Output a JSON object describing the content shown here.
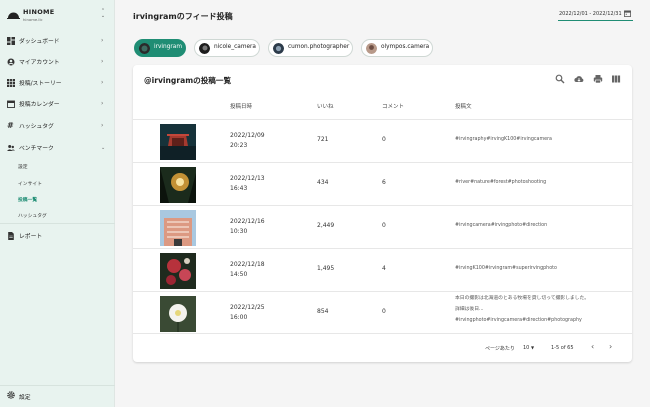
{
  "brand": {
    "name": "HINOME",
    "sub": "hinome.llc"
  },
  "sidebar": {
    "items": [
      {
        "label": "ダッシュボード"
      },
      {
        "label": "マイアカウント"
      },
      {
        "label": "投稿/ストーリー"
      },
      {
        "label": "投稿カレンダー"
      },
      {
        "label": "ハッシュタグ"
      },
      {
        "label": "ベンチマーク"
      }
    ],
    "sub_items": [
      {
        "label": "設定"
      },
      {
        "label": "インサイト"
      },
      {
        "label": "投稿一覧"
      },
      {
        "label": "ハッシュタグ"
      }
    ],
    "report": "レポート",
    "settings": "設定"
  },
  "header": {
    "title": "irvingramのフィード投稿",
    "date_range": "2022/12/01 - 2022/12/31"
  },
  "accounts": [
    {
      "name": "irvingram",
      "active": true
    },
    {
      "name": "nicole_camera",
      "active": false
    },
    {
      "name": "cumon.photographer",
      "active": false
    },
    {
      "name": "olympos.camera",
      "active": false
    }
  ],
  "table": {
    "title": "@irvingramの投稿一覧",
    "headers": {
      "date": "投稿日時",
      "likes": "いいね",
      "comments": "コメント",
      "text": "投稿文"
    },
    "rows": [
      {
        "date": "2022/12/09",
        "time": "20:23",
        "likes": "721",
        "comments": "0",
        "text": "#irvingraphy#irvingK100#irvingcamera"
      },
      {
        "date": "2022/12/13",
        "time": "16:43",
        "likes": "434",
        "comments": "6",
        "text": "#river#nature#forest#photoshooting"
      },
      {
        "date": "2022/12/16",
        "time": "10:30",
        "likes": "2,449",
        "comments": "0",
        "text": "#irvingcamera#irvingphoto#direction"
      },
      {
        "date": "2022/12/18",
        "time": "14:50",
        "likes": "1,495",
        "comments": "4",
        "text": "#irvingK100#irvingram#superirvingphoto"
      },
      {
        "date": "2022/12/25",
        "time": "16:00",
        "likes": "854",
        "comments": "0",
        "text_lines": [
          "本日の撮影は北海道のとある牧場を貸し切って撮影しました。",
          "詳細は後日...",
          "#irvingphoto#irvingcamera#direction#photography"
        ]
      }
    ]
  },
  "pagination": {
    "rows_label": "ページあたり",
    "rows_value": "10",
    "range": "1-5 of 65"
  },
  "colors": {
    "accent": "#1f8d74",
    "sidebar_bg": "#e8f3ef"
  }
}
